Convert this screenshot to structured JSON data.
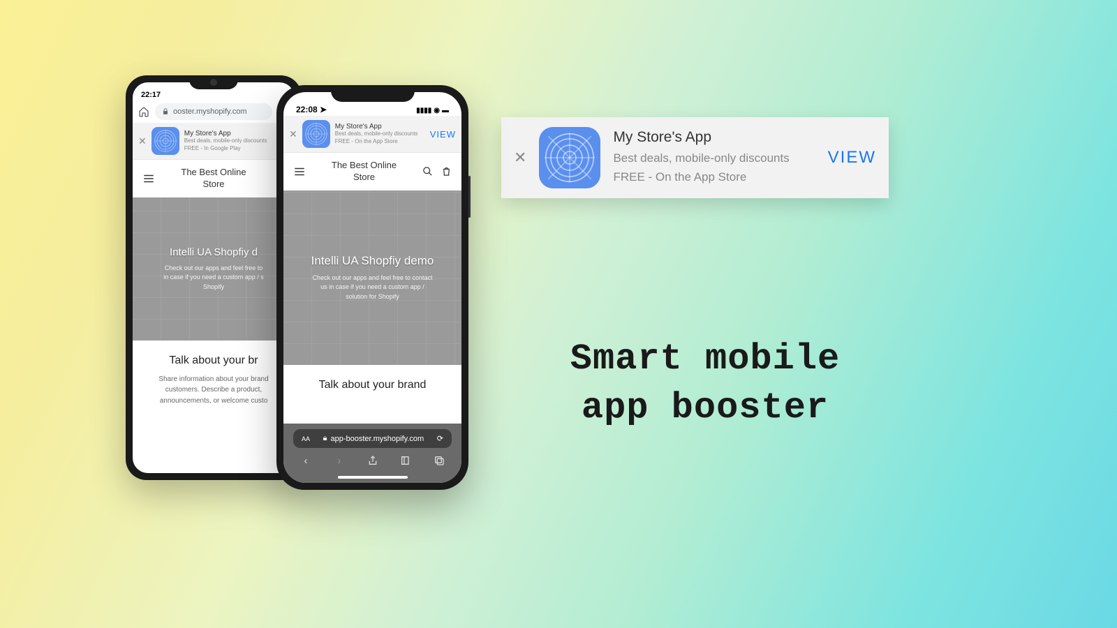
{
  "headline": {
    "line1": "Smart mobile",
    "line2": "app booster"
  },
  "banner_card": {
    "app_name": "My Store's App",
    "tagline": "Best deals, mobile-only discounts",
    "availability": "FREE - On the App Store",
    "cta": "VIEW"
  },
  "phone_android": {
    "time": "22:17",
    "url": "ooster.myshopify.com",
    "banner": {
      "app_name": "My Store's App",
      "tagline": "Best deals, mobile-only discounts",
      "availability": "FREE - In Google Play"
    },
    "store_title_l1": "The Best Online",
    "store_title_l2": "Store",
    "hero_title": "Intelli UA Shopfiy d",
    "hero_sub_l1": "Check out our apps and feel free to",
    "hero_sub_l2": "in case if you need a custom app / s",
    "hero_sub_l3": "Shopify",
    "talk_title": "Talk about your br",
    "talk_sub_l1": "Share information about your brand",
    "talk_sub_l2": "customers. Describe a product,",
    "talk_sub_l3": "announcements, or welcome custo"
  },
  "phone_ios": {
    "time": "22:08",
    "url": "app-booster.myshopify.com",
    "banner": {
      "app_name": "My Store's App",
      "tagline": "Best deals, mobile-only discounts",
      "availability": "FREE - On the App Store",
      "cta": "VIEW"
    },
    "store_title_l1": "The Best Online",
    "store_title_l2": "Store",
    "hero_title": "Intelli UA Shopfiy demo",
    "hero_sub_l1": "Check out our apps and feel free to contact",
    "hero_sub_l2": "us in case if you need a custom app /",
    "hero_sub_l3": "solution for Shopify",
    "talk_title": "Talk about your brand"
  }
}
